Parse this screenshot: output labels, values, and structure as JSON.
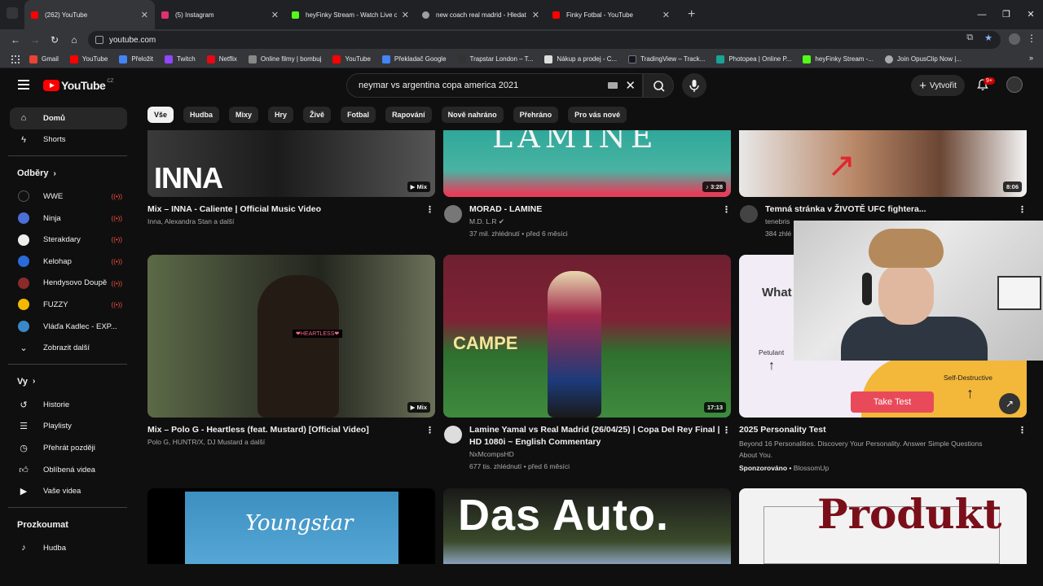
{
  "browser": {
    "tabs": [
      {
        "title": "(262) YouTube",
        "color": "#ff0000",
        "active": true
      },
      {
        "title": "(5) Instagram",
        "color": "#e1306c",
        "active": false
      },
      {
        "title": "heyFinky Stream - Watch Live o",
        "color": "#53fc18",
        "active": false
      },
      {
        "title": "new coach real madrid - Hledat",
        "color": "#9aa0a6",
        "active": false
      },
      {
        "title": "Finky Fotbal - YouTube",
        "color": "#ff0000",
        "active": false
      }
    ],
    "new_tab": "+",
    "window_controls": [
      "—",
      "❐",
      "✕"
    ],
    "url": "youtube.com",
    "bookmarks": [
      {
        "label": "Gmail",
        "color": "#ea4335"
      },
      {
        "label": "YouTube",
        "color": "#ff0000"
      },
      {
        "label": "Přeložit",
        "color": "#4285f4"
      },
      {
        "label": "Twitch",
        "color": "#9146ff"
      },
      {
        "label": "Netflix",
        "color": "#e50914"
      },
      {
        "label": "Online filmy | bombuj",
        "color": "#888888"
      },
      {
        "label": "YouTube",
        "color": "#ff0000"
      },
      {
        "label": "Překladač Google",
        "color": "#4285f4"
      },
      {
        "label": "Trapstar London – T...",
        "color": "#333333"
      },
      {
        "label": "Nákup a prodej - C...",
        "color": "#dddddd"
      },
      {
        "label": "TradingView – Track...",
        "color": "#131722"
      },
      {
        "label": "Photopea | Online P...",
        "color": "#18a497"
      },
      {
        "label": "heyFinky Stream -...",
        "color": "#53fc18"
      },
      {
        "label": "Join OpusClip Now |...",
        "color": "#aaaaaa"
      }
    ],
    "bookmarks_more": "»"
  },
  "masthead": {
    "logo": "YouTube",
    "country": "CZ",
    "search_value": "neymar vs argentina copa america 2021",
    "create_label": "Vytvořit",
    "notif_count": "9+"
  },
  "sidebar": {
    "main": [
      {
        "label": "Domů",
        "icon": "home-icon",
        "active": true
      },
      {
        "label": "Shorts",
        "icon": "shorts-icon",
        "active": false
      }
    ],
    "subs_heading": "Odběry",
    "channels": [
      {
        "label": "WWE",
        "color": "#111111",
        "live": true
      },
      {
        "label": "Ninja",
        "color": "#4a6fd6",
        "live": true
      },
      {
        "label": "Sterakdary",
        "color": "#eeeeee",
        "live": true
      },
      {
        "label": "Kelohap",
        "color": "#2a6ad9",
        "live": true
      },
      {
        "label": "Hendysovo Doupě",
        "color": "#8a2a2a",
        "live": true
      },
      {
        "label": "FUZZY",
        "color": "#f5b800",
        "live": true
      },
      {
        "label": "Vláďa Kadlec - EXP...",
        "color": "#3a88c8",
        "live": false
      }
    ],
    "show_more": "Zobrazit další",
    "you_heading": "Vy",
    "you_items": [
      {
        "label": "Historie",
        "icon": "history-icon"
      },
      {
        "label": "Playlisty",
        "icon": "playlist-icon"
      },
      {
        "label": "Přehrát později",
        "icon": "watch-later-icon"
      },
      {
        "label": "Oblíbená videa",
        "icon": "like-icon"
      },
      {
        "label": "Vaše videa",
        "icon": "your-videos-icon"
      }
    ],
    "explore_heading": "Prozkoumat",
    "explore_items": [
      {
        "label": "Hudba",
        "icon": "music-icon"
      }
    ]
  },
  "chips": [
    "Vše",
    "Hudba",
    "Mixy",
    "Hry",
    "Živě",
    "Fotbal",
    "Rapování",
    "Nově nahráno",
    "Přehráno",
    "Pro vás nové"
  ],
  "videos": [
    {
      "title": "Mix – INNA - Caliente | Official Music Video",
      "channel": "Inna, Alexandra Stan a další",
      "stats": "",
      "duration": "Mix",
      "thumb_text": "INNA"
    },
    {
      "title": "MORAD - LAMINE",
      "channel": "M.D. L.R",
      "stats": "37 mil. zhlédnutí • před 6 měsíci",
      "duration": "3:28",
      "thumb_text": "LAMINE"
    },
    {
      "title": "Temná stránka v ŽIVOTĚ UFC fightera...",
      "channel": "tenebris",
      "stats": "384 zhlé",
      "duration": "8:06",
      "thumb_text": ""
    },
    {
      "title": "Mix – Polo G - Heartless (feat. Mustard) [Official Video]",
      "channel": "Polo G, HUNTR/X, DJ Mustard a další",
      "stats": "",
      "duration": "Mix",
      "thumb_text": "HEARTLESS"
    },
    {
      "title_line1": "Lamine Yamal vs Real Madrid (26/04/25) | Copa Del Rey Final |",
      "title_line2": "HD 1080i ~ English Commentary",
      "channel": "NxMcompsHD",
      "stats": "677 tis. zhlédnutí • před 6 měsíci",
      "duration": "17:13",
      "thumb_text": "CAMPE"
    },
    {
      "title": "2025 Personality Test",
      "desc_line1": "Beyond 16 Personalities. Discovery Your Personality. Answer Simple Questions",
      "desc_line2": "About You.",
      "sponsored": "Sponzorováno",
      "advertiser": "BlossomUp",
      "thumb_what": "What",
      "thumb_petulant": "Petulant",
      "thumb_selfd": "Self-Destructive",
      "cta": "Take Test"
    },
    {
      "thumb_text": "Youngstar"
    },
    {
      "thumb_text": "Das Auto."
    },
    {
      "thumb_text": "Produkt"
    }
  ]
}
